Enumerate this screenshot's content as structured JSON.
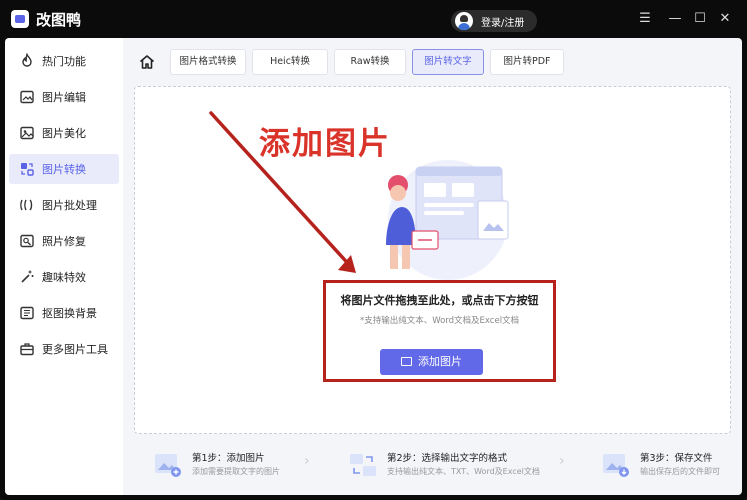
{
  "app": {
    "title": "改图鸭",
    "login_label": "登录/注册"
  },
  "window_controls": {
    "menu": "☰",
    "minimize": "—",
    "maximize": "☐",
    "close": "✕"
  },
  "sidebar": {
    "items": [
      {
        "label": "热门功能",
        "icon": "fire-icon",
        "active": false
      },
      {
        "label": "图片编辑",
        "icon": "image-edit-icon",
        "active": false
      },
      {
        "label": "图片美化",
        "icon": "image-beautify-icon",
        "active": false
      },
      {
        "label": "图片转换",
        "icon": "convert-icon",
        "active": true
      },
      {
        "label": "图片批处理",
        "icon": "batch-icon",
        "active": false
      },
      {
        "label": "照片修复",
        "icon": "photo-repair-icon",
        "active": false
      },
      {
        "label": "趣味特效",
        "icon": "magic-wand-icon",
        "active": false
      },
      {
        "label": "抠图换背景",
        "icon": "cutout-icon",
        "active": false
      },
      {
        "label": "更多图片工具",
        "icon": "toolbox-icon",
        "active": false
      }
    ]
  },
  "tabs": [
    {
      "label": "图片格式转换",
      "active": false
    },
    {
      "label": "Heic转换",
      "active": false
    },
    {
      "label": "Raw转换",
      "active": false
    },
    {
      "label": "图片转文字",
      "active": true
    },
    {
      "label": "图片转PDF",
      "active": false
    }
  ],
  "dropzone": {
    "annotation": "添加图片",
    "main_text": "将图片文件拖拽至此处，或点击下方按钮",
    "sub_text": "*支持输出纯文本、Word文档及Excel文档",
    "button_label": "添加图片"
  },
  "steps": [
    {
      "title": "第1步：添加图片",
      "desc": "添加需要提取文字的图片"
    },
    {
      "title": "第2步：选择输出文字的格式",
      "desc": "支持输出纯文本、TXT、Word及Excel文档"
    },
    {
      "title": "第3步：保存文件",
      "desc": "输出保存后的文件即可"
    }
  ],
  "colors": {
    "accent": "#6169e8",
    "annotation_red": "#d9332a",
    "box_red": "#b6231d"
  }
}
